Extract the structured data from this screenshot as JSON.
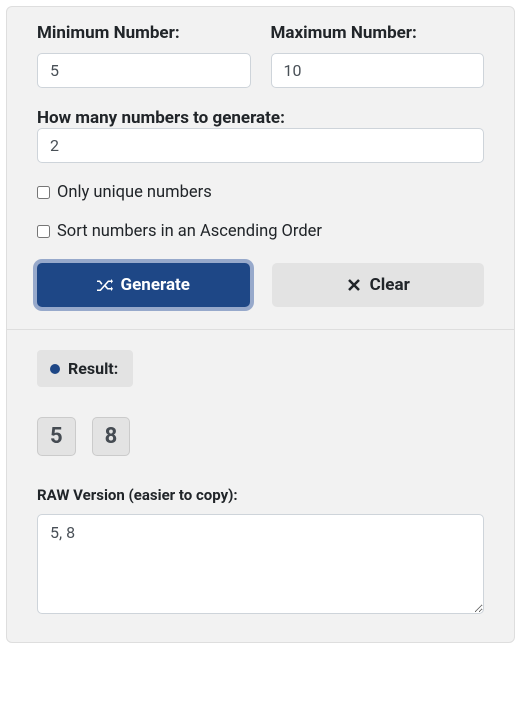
{
  "form": {
    "min": {
      "label": "Minimum Number:",
      "value": "5"
    },
    "max": {
      "label": "Maximum Number:",
      "value": "10"
    },
    "count": {
      "label": "How many numbers to generate:",
      "value": "2"
    },
    "unique": {
      "label": "Only unique numbers",
      "checked": false
    },
    "sort": {
      "label": "Sort numbers in an Ascending Order",
      "checked": false
    },
    "buttons": {
      "generate": "Generate",
      "clear": "Clear"
    }
  },
  "result": {
    "badge_label": "Result:",
    "numbers": [
      "5",
      "8"
    ],
    "raw_label": "RAW Version (easier to copy):",
    "raw_value": "5, 8"
  }
}
